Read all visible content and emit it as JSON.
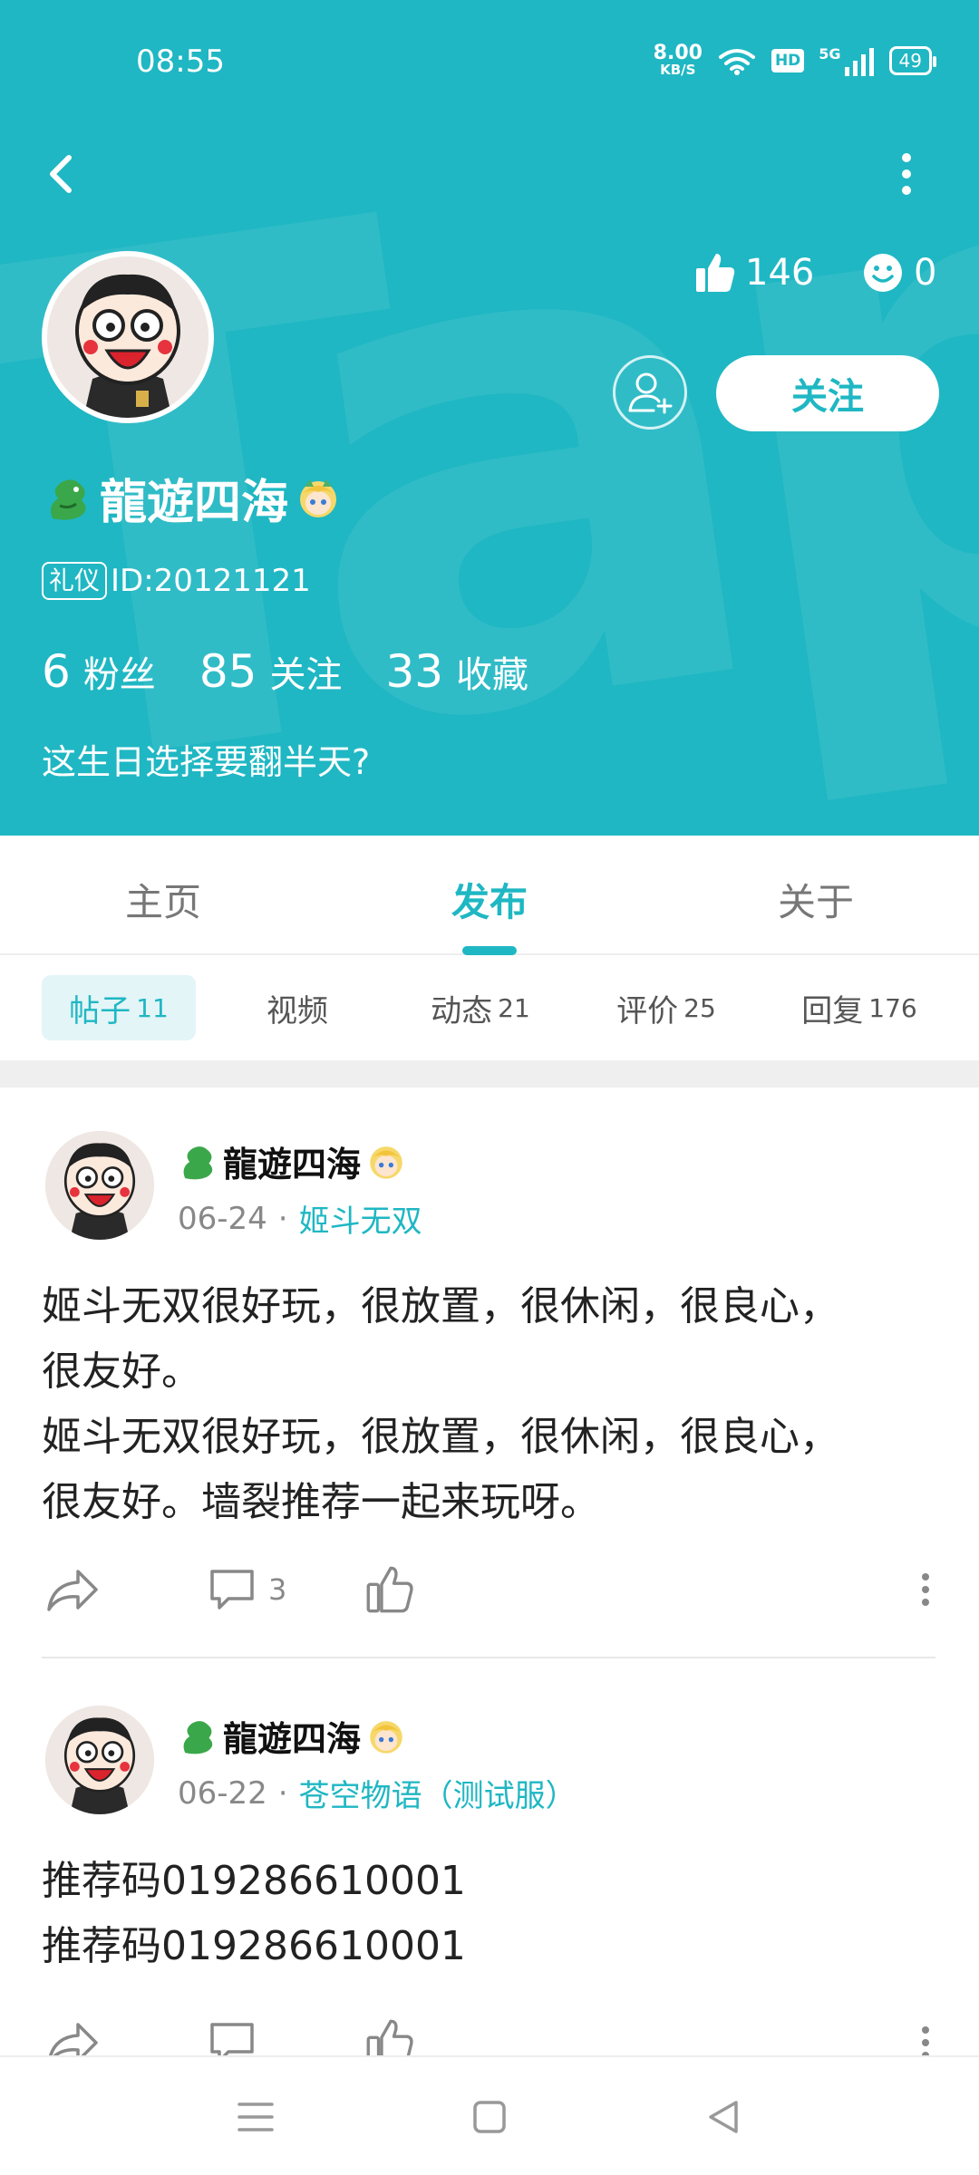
{
  "status_bar": {
    "time": "08:55",
    "net_speed_value": "8.00",
    "net_speed_unit": "KB/S",
    "hd": "HD",
    "network": "5G",
    "battery": "49"
  },
  "header": {
    "watermark": "Tap",
    "likes": "146",
    "smiles": "0",
    "follow_label": "关注",
    "user_name": "龍遊四海",
    "title_tag": "礼仪",
    "user_id": "ID:20121121",
    "stats": [
      {
        "num": "6",
        "label": "粉丝"
      },
      {
        "num": "85",
        "label": "关注"
      },
      {
        "num": "33",
        "label": "收藏"
      }
    ],
    "bio": "这生日选择要翻半天?"
  },
  "main_tabs": [
    "主页",
    "发布",
    "关于"
  ],
  "active_main_tab": "发布",
  "sub_tabs": [
    {
      "label": "帖子",
      "count": "11"
    },
    {
      "label": "视频",
      "count": ""
    },
    {
      "label": "动态",
      "count": "21"
    },
    {
      "label": "评价",
      "count": "25"
    },
    {
      "label": "回复",
      "count": "176"
    }
  ],
  "posts": [
    {
      "author": "龍遊四海",
      "date": "06-24",
      "dot": "·",
      "game": "姬斗无双",
      "text_lines": [
        "姬斗无双很好玩，很放置，很休闲，很良心，",
        "很友好。",
        "姬斗无双很好玩，很放置，很休闲，很良心，",
        "很友好。墙裂推荐一起来玩呀。"
      ],
      "comments": "3"
    },
    {
      "author": "龍遊四海",
      "date": "06-22",
      "dot": "·",
      "game": "苍空物语（测试服）",
      "text_lines": [
        "推荐码019286610001",
        "推荐码019286610001"
      ],
      "comments": ""
    }
  ],
  "colors": {
    "accent": "#1fb7c3",
    "header_bg": "#1fb7c3"
  }
}
